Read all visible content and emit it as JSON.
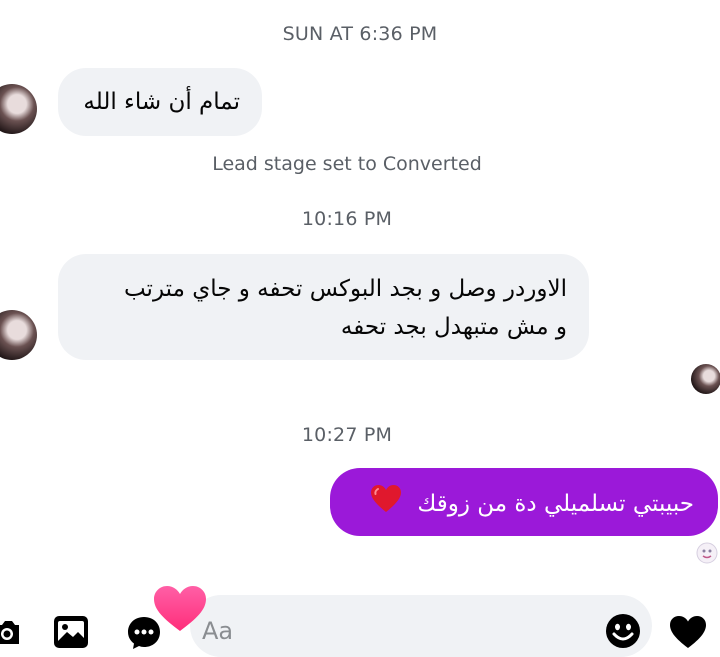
{
  "chat": {
    "timestamp_1": "SUN AT 6:36 PM",
    "message_1": "تمام أن شاء الله",
    "system_event": "Lead stage set to Converted",
    "timestamp_2": "10:16 PM",
    "message_2_line_1": "الاوردر وصل و بجد البوكس تحفه و جاي مترتب",
    "message_2_line_2": "و مش متبهدل بجد تحفه",
    "timestamp_3": "10:27 PM",
    "message_3": "حبيبتي تسلميلي دة من زوقك"
  },
  "composer": {
    "placeholder": "Aa"
  },
  "colors": {
    "outgoing_bubble": "#9b19d9",
    "incoming_bubble": "#f0f2f5",
    "heart_accent": "#ff3b8d"
  }
}
